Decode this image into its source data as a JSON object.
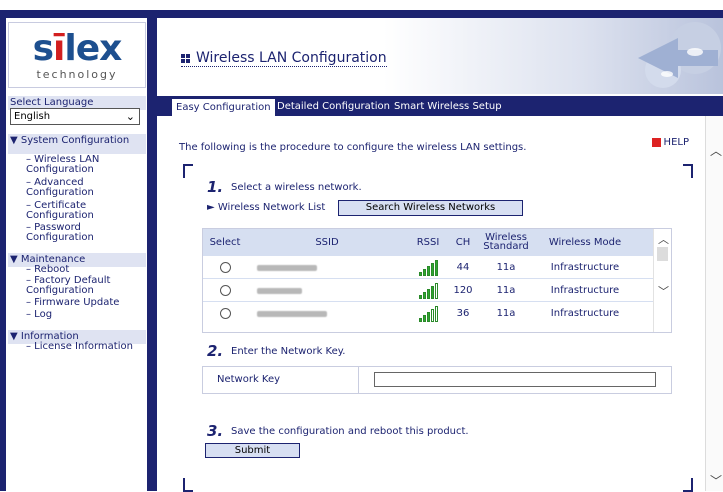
{
  "sidebar": {
    "logo_brand": "silex",
    "logo_sub": "technology",
    "select_language_label": "Select Language",
    "language_value": "English",
    "sections": [
      {
        "title": "▼ System Configuration",
        "items": [
          "– Wireless LAN Configuration",
          "– Advanced Configuration",
          "– Certificate Configuration",
          "– Password Configuration"
        ]
      },
      {
        "title": "▼ Maintenance",
        "items": [
          "– Reboot",
          "– Factory Default Configuration",
          "– Firmware Update",
          "– Log"
        ]
      },
      {
        "title": "▼ Information",
        "items": [
          "– License Information"
        ]
      }
    ]
  },
  "header": {
    "title": "Wireless LAN Configuration"
  },
  "tabs": [
    {
      "label": "Easy Configuration",
      "active": true
    },
    {
      "label": "Detailed Configuration",
      "active": false
    },
    {
      "label": "Smart Wireless Setup",
      "active": false
    }
  ],
  "content": {
    "intro": "The following is the procedure to configure the wireless LAN settings.",
    "help_label": "HELP",
    "step1": {
      "num": "1.",
      "text": "Select a wireless network."
    },
    "network_list_label": "Wireless Network List",
    "search_button": "Search Wireless Networks",
    "table": {
      "headers": {
        "select": "Select",
        "ssid": "SSID",
        "rssi": "RSSI",
        "ch": "CH",
        "standard": "Wireless Standard",
        "mode": "Wireless Mode"
      },
      "rows": [
        {
          "ch": "44",
          "standard": "11a",
          "mode": "Infrastructure",
          "signal": 5
        },
        {
          "ch": "120",
          "standard": "11a",
          "mode": "Infrastructure",
          "signal": 4
        },
        {
          "ch": "36",
          "standard": "11a",
          "mode": "Infrastructure",
          "signal": 3
        }
      ]
    },
    "step2": {
      "num": "2.",
      "text": "Enter the Network Key."
    },
    "network_key_label": "Network Key",
    "step3": {
      "num": "3.",
      "text": "Save the configuration and reboot this product."
    },
    "submit_button": "Submit"
  },
  "colors": {
    "navy": "#1c2370",
    "table_header": "#d6dff1",
    "button": "#d7dff2",
    "signal_green": "#2fa82f"
  }
}
